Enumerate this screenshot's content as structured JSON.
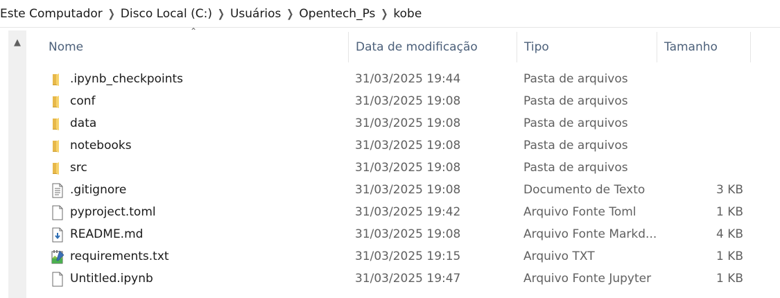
{
  "breadcrumb": [
    "Este Computador",
    "Disco Local (C:)",
    "Usuários",
    "Opentech_Ps",
    "kobe"
  ],
  "columns": {
    "name": "Nome",
    "date": "Data de modificação",
    "type": "Tipo",
    "size": "Tamanho"
  },
  "files": [
    {
      "name": ".ipynb_checkpoints",
      "date": "31/03/2025 19:44",
      "type": "Pasta de arquivos",
      "size": "",
      "icon": "folder-icon"
    },
    {
      "name": "conf",
      "date": "31/03/2025 19:08",
      "type": "Pasta de arquivos",
      "size": "",
      "icon": "folder-icon"
    },
    {
      "name": "data",
      "date": "31/03/2025 19:08",
      "type": "Pasta de arquivos",
      "size": "",
      "icon": "folder-icon"
    },
    {
      "name": "notebooks",
      "date": "31/03/2025 19:08",
      "type": "Pasta de arquivos",
      "size": "",
      "icon": "folder-icon"
    },
    {
      "name": "src",
      "date": "31/03/2025 19:08",
      "type": "Pasta de arquivos",
      "size": "",
      "icon": "folder-icon"
    },
    {
      "name": ".gitignore",
      "date": "31/03/2025 19:08",
      "type": "Documento de Texto",
      "size": "3 KB",
      "icon": "text-document-icon"
    },
    {
      "name": "pyproject.toml",
      "date": "31/03/2025 19:42",
      "type": "Arquivo Fonte Toml",
      "size": "1 KB",
      "icon": "generic-file-icon"
    },
    {
      "name": "README.md",
      "date": "31/03/2025 19:08",
      "type": "Arquivo Fonte Markd...",
      "size": "4 KB",
      "icon": "markdown-file-icon"
    },
    {
      "name": "requirements.txt",
      "date": "31/03/2025 19:15",
      "type": "Arquivo TXT",
      "size": "1 KB",
      "icon": "notepad-file-icon"
    },
    {
      "name": "Untitled.ipynb",
      "date": "31/03/2025 19:47",
      "type": "Arquivo Fonte Jupyter",
      "size": "1 KB",
      "icon": "generic-file-icon"
    }
  ]
}
